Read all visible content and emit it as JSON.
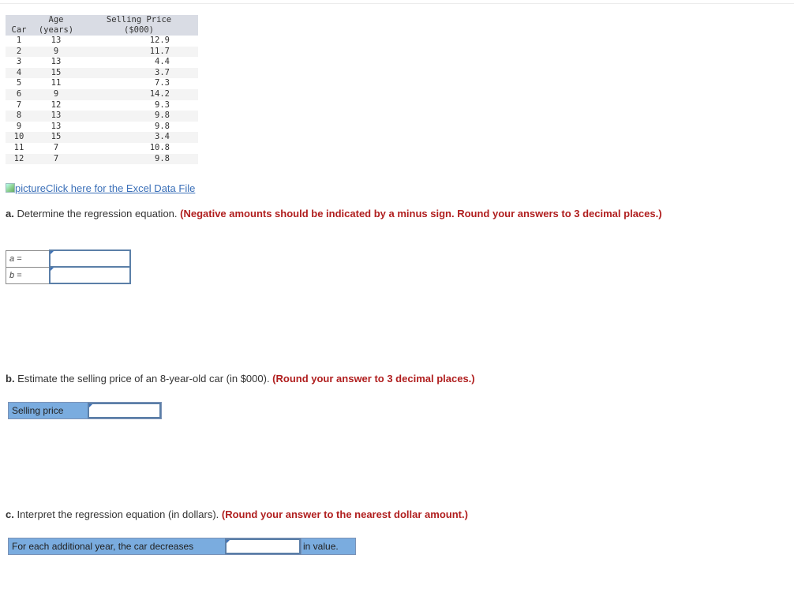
{
  "table": {
    "headers": {
      "car": [
        "",
        "Car"
      ],
      "age": [
        "Age",
        "(years)"
      ],
      "price": [
        "Selling Price",
        "($000)"
      ]
    },
    "rows": [
      {
        "car": "1",
        "age": "13",
        "price": "12.9"
      },
      {
        "car": "2",
        "age": "9",
        "price": "11.7"
      },
      {
        "car": "3",
        "age": "13",
        "price": "4.4"
      },
      {
        "car": "4",
        "age": "15",
        "price": "3.7"
      },
      {
        "car": "5",
        "age": "11",
        "price": "7.3"
      },
      {
        "car": "6",
        "age": "9",
        "price": "14.2"
      },
      {
        "car": "7",
        "age": "12",
        "price": "9.3"
      },
      {
        "car": "8",
        "age": "13",
        "price": "9.8"
      },
      {
        "car": "9",
        "age": "13",
        "price": "9.8"
      },
      {
        "car": "10",
        "age": "15",
        "price": "3.4"
      },
      {
        "car": "11",
        "age": "7",
        "price": "10.8"
      },
      {
        "car": "12",
        "age": "7",
        "price": "9.8"
      }
    ]
  },
  "excel_link": {
    "alt_text": "picture",
    "label": "Click here for the Excel Data File"
  },
  "question_a": {
    "label": "a.",
    "text": " Determine the regression equation. ",
    "instruction": "(Negative amounts should be indicated by a minus sign. Round your answers to 3 decimal places.)",
    "fields": [
      {
        "label": "a =",
        "value": ""
      },
      {
        "label": "b =",
        "value": ""
      }
    ]
  },
  "question_b": {
    "label": "b.",
    "text": " Estimate the selling price of an 8-year-old car (in $000). ",
    "instruction": "(Round your answer to 3 decimal places.)",
    "field_label": "Selling price",
    "value": ""
  },
  "question_c": {
    "label": "c.",
    "text": " Interpret the regression equation (in dollars). ",
    "instruction": "(Round your answer to the nearest dollar amount.)",
    "prefix": "For each additional year, the car decreases",
    "suffix": "in value.",
    "value": ""
  }
}
